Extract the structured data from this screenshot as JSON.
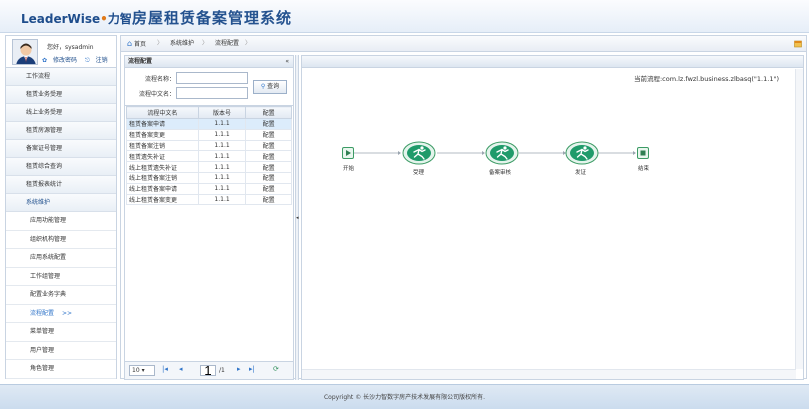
{
  "app": {
    "logo_main": "LeaderWise",
    "logo_dot": "•",
    "logo_cn": "力智",
    "title": "房屋租赁备案管理系统"
  },
  "user": {
    "greeting": "您好，sysadmin",
    "change_pwd": "修改密码",
    "logout": "注销"
  },
  "sidebar": {
    "items": [
      {
        "label": "工作流程"
      },
      {
        "label": "租赁业务受理"
      },
      {
        "label": "线上业务受理"
      },
      {
        "label": "租赁房源管理"
      },
      {
        "label": "备案证号管理"
      },
      {
        "label": "租赁综合查询"
      },
      {
        "label": "租赁报表统计"
      },
      {
        "label": "系统维护"
      }
    ],
    "subitems": [
      {
        "label": "应用功能管理"
      },
      {
        "label": "组织机构管理"
      },
      {
        "label": "应用系统配置"
      },
      {
        "label": "工作组管理"
      },
      {
        "label": "配置业务字典"
      },
      {
        "label": "流程配置",
        "marker": ">>"
      },
      {
        "label": "菜单管理"
      },
      {
        "label": "用户管理"
      },
      {
        "label": "角色管理"
      }
    ]
  },
  "breadcrumb": {
    "home": "首页",
    "level1": "系统维护",
    "level2": "流程配置"
  },
  "left_panel": {
    "title": "流程配置",
    "collapse_glyph": "«",
    "form": {
      "name_label": "流程名称：",
      "cn_label": "流程中文名：",
      "name_value": "",
      "cn_value": "",
      "query_label": "查询"
    },
    "table": {
      "headers": [
        "流程中文名",
        "版本号",
        "配置"
      ],
      "rows": [
        [
          "租赁备案申请",
          "1.1.1",
          "配置"
        ],
        [
          "租赁备案变更",
          "1.1.1",
          "配置"
        ],
        [
          "租赁备案注销",
          "1.1.1",
          "配置"
        ],
        [
          "租赁遗失补证",
          "1.1.1",
          "配置"
        ],
        [
          "线上租赁遗失补证",
          "1.1.1",
          "配置"
        ],
        [
          "线上租赁备案注销",
          "1.1.1",
          "配置"
        ],
        [
          "线上租赁备案申请",
          "1.1.1",
          "配置"
        ],
        [
          "线上租赁备案变更",
          "1.1.1",
          "配置"
        ]
      ]
    },
    "pager": {
      "page_size": "10",
      "page_input": "1",
      "page_total": "/1"
    }
  },
  "right_panel": {
    "current_flow": "当前流程:com.lz.fwzl.business.zlbasq(\"1.1.1\")",
    "flow": {
      "start": "开始",
      "step1": "受理",
      "step2": "备案审核",
      "step3": "发证",
      "end": "结束"
    }
  },
  "footer": {
    "copyright": "Copyright © 长沙力智数字房产技术发展有限公司版权所有."
  },
  "colors": {
    "accent": "#2f74c9",
    "brand": "#24528f",
    "flow_green": "#1f9b6a"
  }
}
